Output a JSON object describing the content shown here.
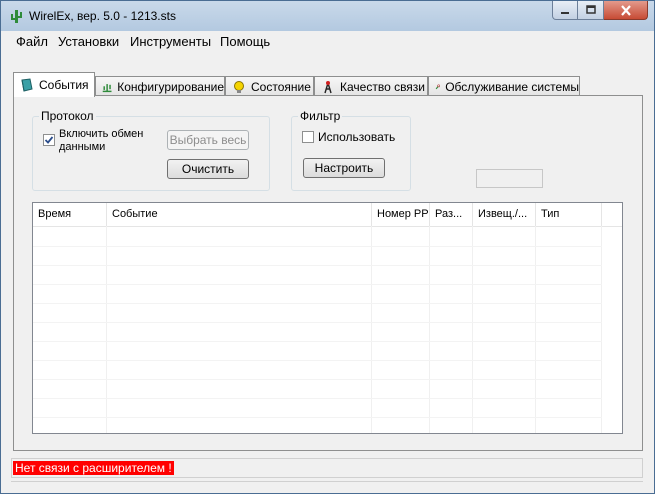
{
  "window": {
    "title": "WirelEx, вер. 5.0 - 1213.sts",
    "accent": "#b3c9e0",
    "close_color": "#c74b35"
  },
  "menu": {
    "file": "Файл",
    "settings": "Установки",
    "tools": "Инструменты",
    "help": "Помощь"
  },
  "tabs": [
    {
      "label": "События",
      "icon": "book-icon"
    },
    {
      "label": "Конфигурирование",
      "icon": "plant-icon"
    },
    {
      "label": "Состояние",
      "icon": "bulb-icon"
    },
    {
      "label": "Качество связи",
      "icon": "antenna-icon"
    },
    {
      "label": "Обслуживание системы",
      "icon": "wrench-icon"
    }
  ],
  "protocol": {
    "group_label": "Протокол",
    "enable_label": "Включить обмен данными",
    "enable_line1": "Включить обмен",
    "enable_line2": "данными",
    "enable_checked": true,
    "select_all_label": "Выбрать весь",
    "clear_label": "Очистить"
  },
  "filter": {
    "group_label": "Фильтр",
    "use_label": "Использовать",
    "use_checked": false,
    "configure_label": "Настроить"
  },
  "table": {
    "columns": [
      "Время",
      "Событие",
      "Номер РР",
      "Раз...",
      "Извещ./...",
      "Тип"
    ],
    "rows": []
  },
  "status": {
    "message": "Нет связи с расширителем !",
    "message_color": "#ff0000"
  }
}
